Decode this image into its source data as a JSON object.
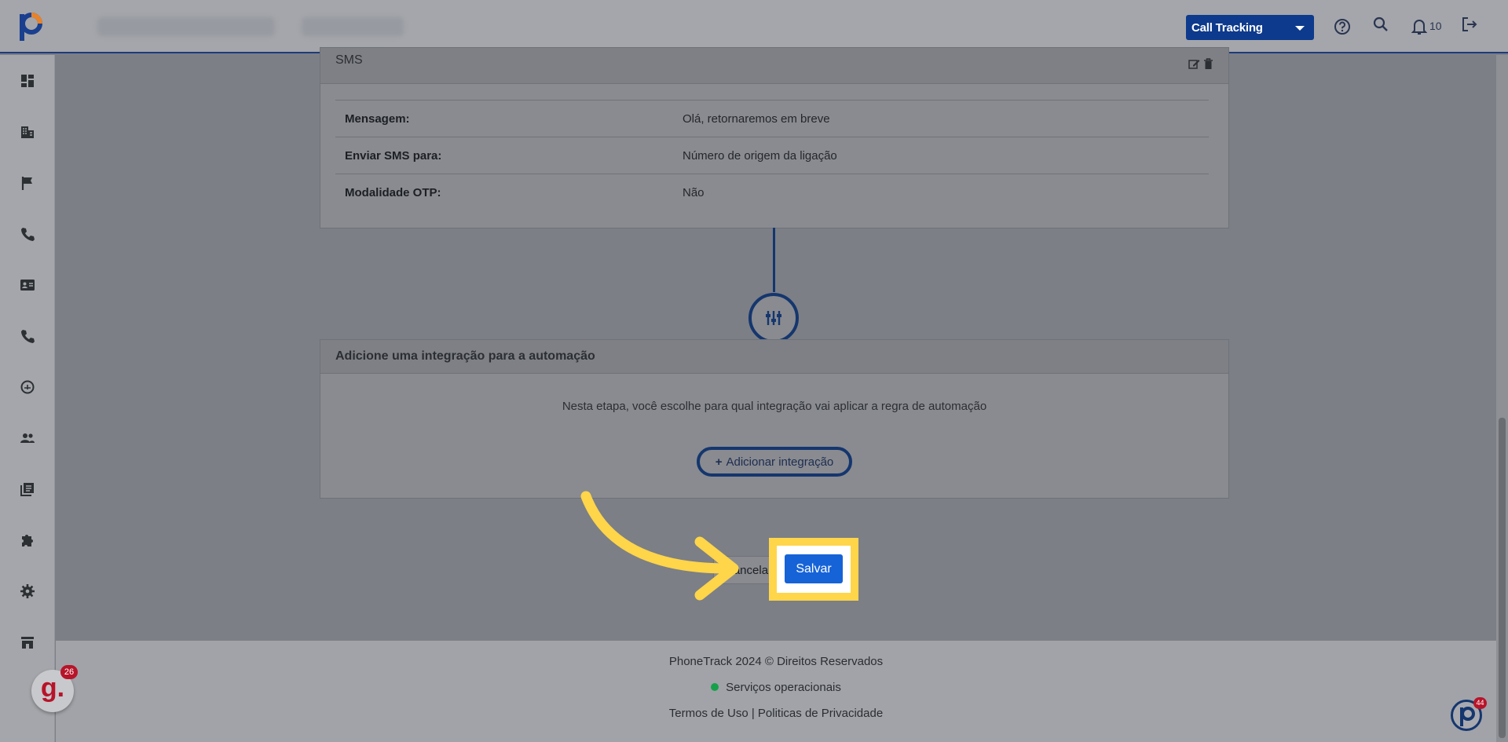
{
  "header": {
    "product_select": "Call Tracking",
    "notifications_count": "10",
    "colors": {
      "header_bg": "#a4a6ab",
      "brand_navy": "#0d3a8c",
      "highlight": "#ffd54a",
      "primary": "#1663d8"
    }
  },
  "sidebar": {
    "items": [
      {
        "icon": "dashboard-icon"
      },
      {
        "icon": "building-icon"
      },
      {
        "icon": "flag-icon"
      },
      {
        "icon": "phone-icon"
      },
      {
        "icon": "contact-card-icon"
      },
      {
        "icon": "phone-call-icon"
      },
      {
        "icon": "gauge-icon"
      },
      {
        "icon": "users-icon"
      },
      {
        "icon": "library-icon"
      },
      {
        "icon": "puzzle-icon"
      },
      {
        "icon": "gear-icon"
      },
      {
        "icon": "store-icon"
      }
    ]
  },
  "sms_card": {
    "title": "SMS",
    "rows": [
      {
        "label": "Mensagem:",
        "value": "Olá, retornaremos em breve"
      },
      {
        "label": "Enviar SMS para:",
        "value": "Número de origem da ligação"
      },
      {
        "label": "Modalidade OTP:",
        "value": "Não"
      }
    ]
  },
  "integration_card": {
    "title": "Adicione uma integração para a automação",
    "description": "Nesta etapa, você escolhe para qual integração vai aplicar a regra de automação",
    "add_button": "Adicionar integração"
  },
  "actions": {
    "cancel_label": "Cancelar",
    "save_label": "Salvar"
  },
  "footer": {
    "copyright": "PhoneTrack 2024 © Direitos Reservados",
    "status": "Serviços operacionais",
    "terms": "Termos de Uso",
    "privacy": "Politicas de Privacidade"
  },
  "widgets": {
    "g_badge_letter": "g.",
    "g_badge_count": "26",
    "p_badge_count": "44"
  }
}
